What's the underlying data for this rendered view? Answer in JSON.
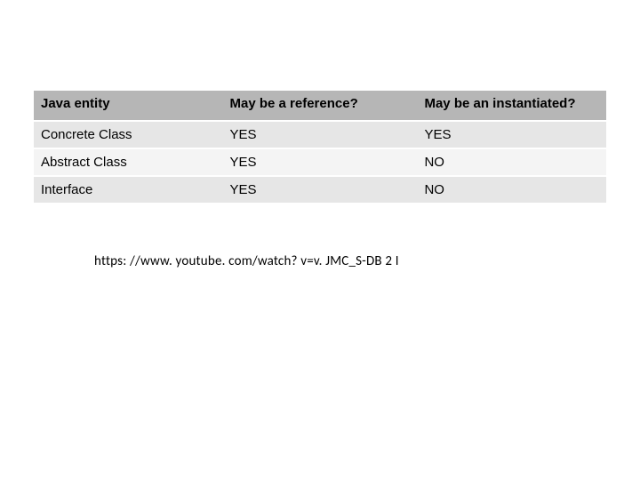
{
  "table": {
    "headers": {
      "entity": "Java entity",
      "reference": "May be a reference?",
      "instantiated": "May be an instantiated?"
    },
    "rows": [
      {
        "entity": "Concrete Class",
        "reference": "YES",
        "instantiated": "YES"
      },
      {
        "entity": "Abstract Class",
        "reference": "YES",
        "instantiated": "NO"
      },
      {
        "entity": "Interface",
        "reference": "YES",
        "instantiated": "NO"
      }
    ]
  },
  "url_text": "https: //www. youtube. com/watch? v=v. JMC_S-DB 2 I"
}
